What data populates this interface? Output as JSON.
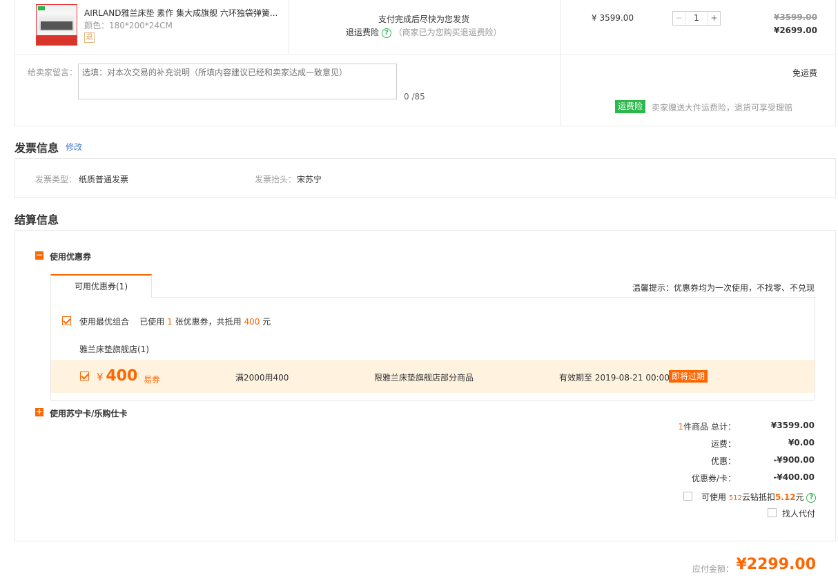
{
  "product": {
    "name": "AIRLAND雅兰床垫 素作 集大成旗舰 六环独袋弹簧...",
    "spec": "颜色：180*200*24CM",
    "return_badge": "退",
    "delivery_note": "支付完成后尽快为您发货",
    "insurance_label": "退运费险",
    "insurance_note": "（商家已为您购买退运费险）",
    "unit_price": "¥ 3599.00",
    "quantity": "1",
    "original_total": "¥3599.00",
    "total": "¥2699.00"
  },
  "seller_message": {
    "label": "给卖家留言：",
    "placeholder": "选填：对本次交易的补充说明（所填内容建议已经和卖家达成一致意见）",
    "count": "0 /85"
  },
  "shipping": {
    "fee_label": "免运费",
    "insurance_badge": "运费险",
    "insurance_text": "卖家赠送大件运费险，退货可享受理赔"
  },
  "invoice": {
    "title": "发票信息",
    "edit": "修改",
    "type_label": "发票类型：",
    "type_value": "纸质普通发票",
    "header_label": "发票抬头：",
    "header_value": "宋苏宁"
  },
  "settlement": {
    "title": "结算信息",
    "coupon_toggle_label": "使用优惠券",
    "coupon_tab": "可用优惠券(1)",
    "coupon_tip": "温馨提示：优惠券均为一次使用，不找零、不兑现",
    "best_combo": {
      "label": "使用最优组合",
      "used_prefix": "已使用",
      "used_count": "1",
      "used_mid": "张优惠券，共抵用",
      "amount": "400",
      "unit": "元"
    },
    "store_name": "雅兰床垫旗舰店(1)",
    "coupon": {
      "currency": "¥",
      "amount": "400",
      "kind": "易券",
      "condition": "满2000用400",
      "scope": "限雅兰床垫旗舰店部分商品",
      "validity": "有效期至 2019-08-21 00:00",
      "expiring": "即将过期"
    },
    "card_toggle_label": "使用苏宁卡/乐购仕卡"
  },
  "summary": {
    "count": "1",
    "items_label": "件商品 总计：",
    "items_total": "¥3599.00",
    "shipping_label": "运费：",
    "shipping_value": "¥0.00",
    "discount_label": "优惠：",
    "discount_value": "-¥900.00",
    "coupon_label": "优惠券/卡：",
    "coupon_value": "-¥400.00",
    "diamond_prefix": "可使用",
    "diamond_count": "512",
    "diamond_mid": "云钻抵扣",
    "diamond_amount": "5.12",
    "diamond_unit": "元",
    "proxy_pay": "找人代付",
    "payable_label": "应付金额：",
    "payable_value": "¥2299.00"
  },
  "colors": {
    "accent": "#ff6600",
    "green": "#2db84d",
    "coupon_bg": "#fff3e0",
    "link": "#3a7bd5"
  }
}
